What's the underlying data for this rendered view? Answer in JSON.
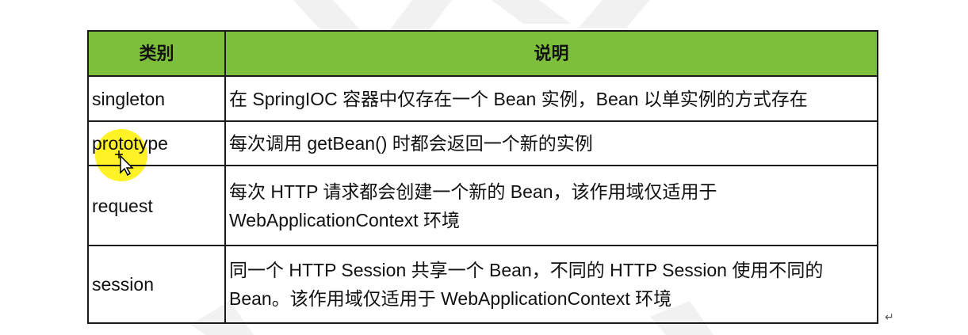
{
  "table": {
    "headers": {
      "category": "类别",
      "description": "说明"
    },
    "rows": [
      {
        "category": "singleton",
        "description": "在 SpringIOC 容器中仅存在一个 Bean 实例，Bean 以单实例的方式存在"
      },
      {
        "category": "prototype",
        "description": "每次调用 getBean() 时都会返回一个新的实例"
      },
      {
        "category": "request",
        "description": "每次 HTTP 请求都会创建一个新的 Bean，该作用域仅适用于 WebApplicationContext 环境"
      },
      {
        "category": "session",
        "description": "同一个 HTTP Session 共享一个 Bean，不同的 HTTP Session 使用不同的 Bean。该作用域仅适用于 WebApplicationContext 环境"
      }
    ]
  },
  "paragraph_mark": "↵",
  "colors": {
    "header_background": "#7dbf3a",
    "border": "#1a1a1a",
    "cursor_highlight": "#fff000"
  },
  "icons": {
    "cursor": "move-cursor-icon"
  }
}
